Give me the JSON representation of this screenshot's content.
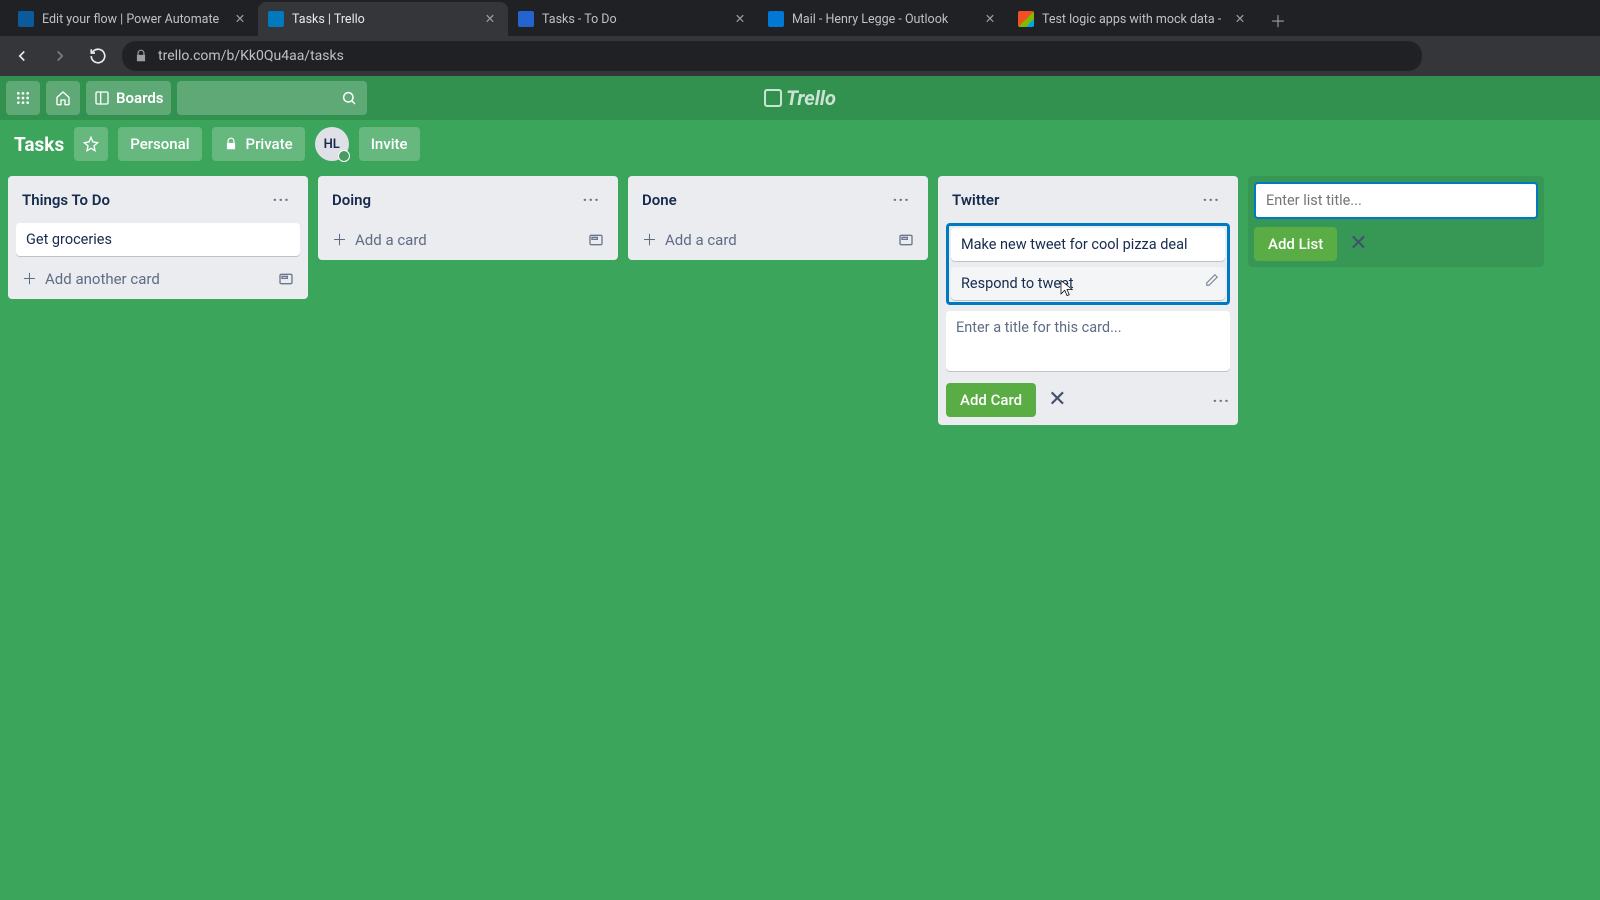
{
  "browser": {
    "tabs": [
      {
        "title": "Edit your flow | Power Automate",
        "favicon": "#0a5a9c"
      },
      {
        "title": "Tasks | Trello",
        "favicon": "#0079bf",
        "active": true
      },
      {
        "title": "Tasks - To Do",
        "favicon": "#2564cf"
      },
      {
        "title": "Mail - Henry Legge - Outlook",
        "favicon": "#0078d4"
      },
      {
        "title": "Test logic apps with mock data -",
        "favicon": "#f25022"
      }
    ],
    "url": "trello.com/b/Kk0Qu4aa/tasks"
  },
  "topnav": {
    "boards": "Boards",
    "brand": "Trello"
  },
  "board_header": {
    "title": "Tasks",
    "personal": "Personal",
    "private": "Private",
    "avatar": "HL",
    "invite": "Invite"
  },
  "lists": {
    "todo": {
      "title": "Things To Do",
      "cards": [
        "Get groceries"
      ],
      "add_another": "Add another card"
    },
    "doing": {
      "title": "Doing",
      "add": "Add a card"
    },
    "done": {
      "title": "Done",
      "add": "Add a card"
    },
    "twitter": {
      "title": "Twitter",
      "cards": [
        "Make new tweet for cool pizza deal",
        "Respond to tweet"
      ],
      "composer_placeholder": "Enter a title for this card...",
      "add_card_btn": "Add Card"
    }
  },
  "add_list": {
    "placeholder": "Enter list title...",
    "button": "Add List"
  }
}
